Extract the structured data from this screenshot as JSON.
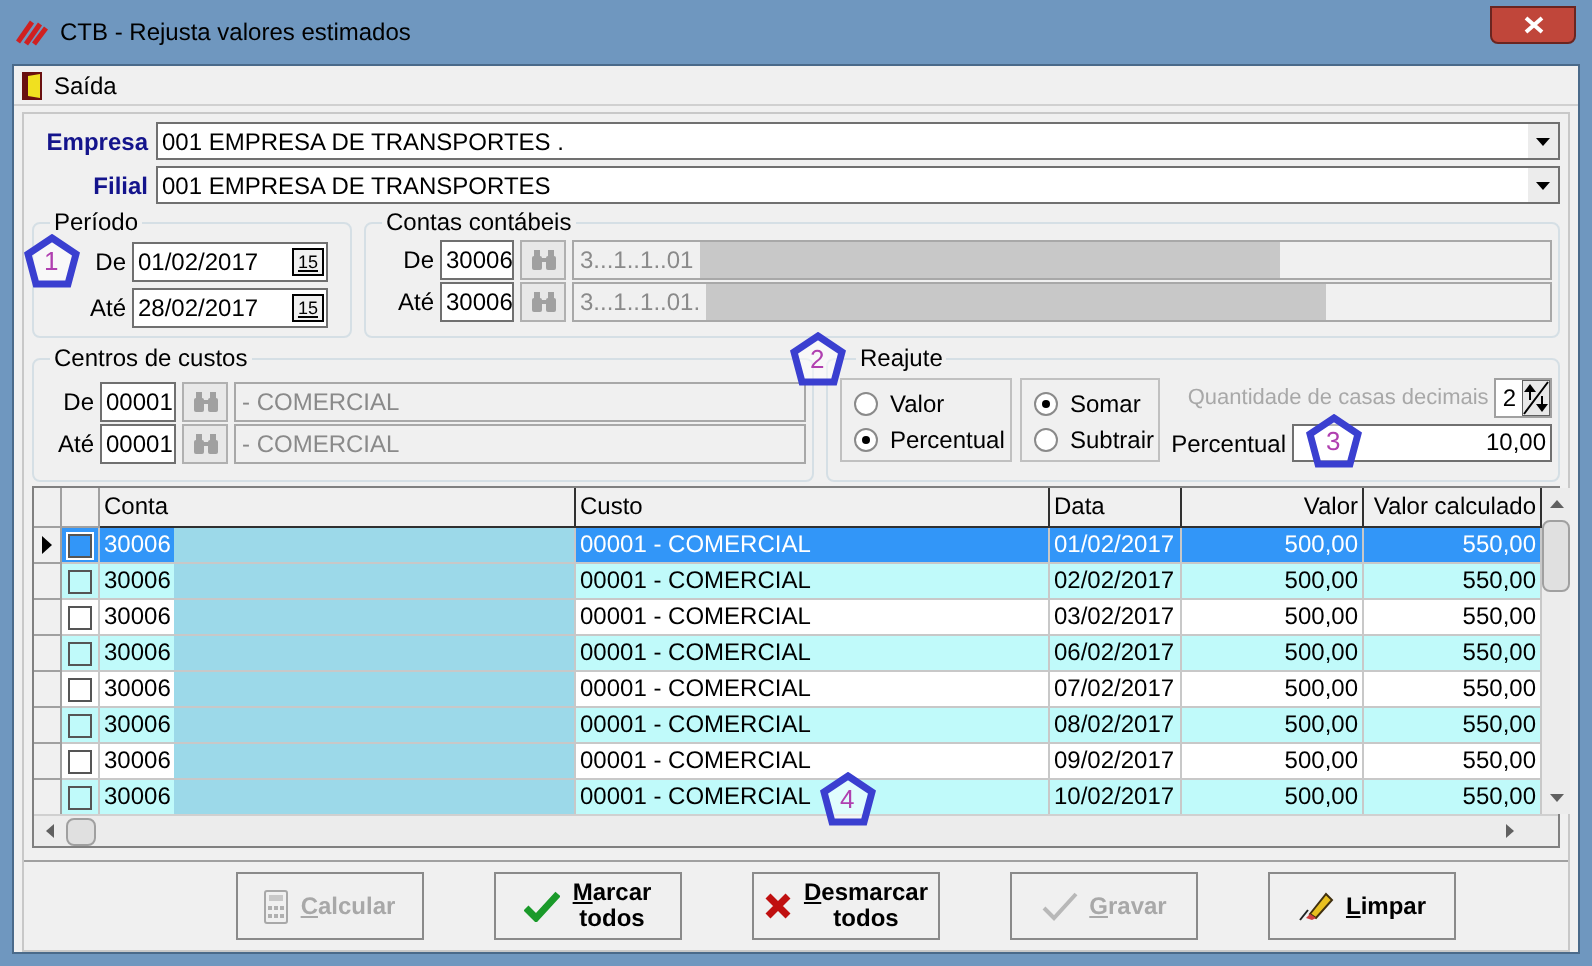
{
  "window": {
    "title": "CTB - Rejusta valores estimados"
  },
  "menu": [
    "Saída"
  ],
  "empresa": {
    "label": "Empresa",
    "value": "001 EMPRESA DE TRANSPORTES ."
  },
  "filial": {
    "label": "Filial",
    "value": "001 EMPRESA DE TRANSPORTES"
  },
  "periodo": {
    "title": "Período",
    "rows": [
      {
        "label": "De",
        "value": "01/02/2017",
        "button": "15"
      },
      {
        "label": "Até",
        "value": "28/02/2017",
        "button": "15"
      }
    ]
  },
  "contas": {
    "title": "Contas contábeis",
    "rows": [
      {
        "label": "De",
        "code": "30006",
        "description": "3...1..1..01"
      },
      {
        "label": "Até",
        "code": "30006",
        "description": "3...1..1..01."
      }
    ]
  },
  "centros": {
    "title": "Centros de custos",
    "rows": [
      {
        "label": "De",
        "code": "00001",
        "description": "- COMERCIAL"
      },
      {
        "label": "Até",
        "code": "00001",
        "description": "- COMERCIAL"
      }
    ]
  },
  "reajute": {
    "title": "Reajute",
    "tipo": [
      {
        "label": "Valor",
        "selected": false
      },
      {
        "label": "Percentual",
        "selected": true
      }
    ],
    "operacao": [
      {
        "label": "Somar",
        "selected": true
      },
      {
        "label": "Subtrair",
        "selected": false
      }
    ],
    "decimais": {
      "label": "Quantidade de casas decimais",
      "value": "2",
      "disabled": true
    },
    "percentual": {
      "label": "Percentual",
      "value": "10,00"
    }
  },
  "table": {
    "columns": [
      "Conta",
      "Custo",
      "Data",
      "Valor",
      "Valor calculado"
    ],
    "rows": [
      {
        "selected": true,
        "checked": false,
        "conta": "30006",
        "custo": "00001 - COMERCIAL",
        "data": "01/02/2017",
        "valor": "500,00",
        "calculado": "550,00"
      },
      {
        "selected": false,
        "checked": false,
        "conta": "30006",
        "custo": "00001 - COMERCIAL",
        "data": "02/02/2017",
        "valor": "500,00",
        "calculado": "550,00"
      },
      {
        "selected": false,
        "checked": false,
        "conta": "30006",
        "custo": "00001 - COMERCIAL",
        "data": "03/02/2017",
        "valor": "500,00",
        "calculado": "550,00"
      },
      {
        "selected": false,
        "checked": false,
        "conta": "30006",
        "custo": "00001 - COMERCIAL",
        "data": "06/02/2017",
        "valor": "500,00",
        "calculado": "550,00"
      },
      {
        "selected": false,
        "checked": false,
        "conta": "30006",
        "custo": "00001 - COMERCIAL",
        "data": "07/02/2017",
        "valor": "500,00",
        "calculado": "550,00"
      },
      {
        "selected": false,
        "checked": false,
        "conta": "30006",
        "custo": "00001 - COMERCIAL",
        "data": "08/02/2017",
        "valor": "500,00",
        "calculado": "550,00"
      },
      {
        "selected": false,
        "checked": false,
        "conta": "30006",
        "custo": "00001 - COMERCIAL",
        "data": "09/02/2017",
        "valor": "500,00",
        "calculado": "550,00"
      },
      {
        "selected": false,
        "checked": false,
        "conta": "30006",
        "custo": "00001 - COMERCIAL",
        "data": "10/02/2017",
        "valor": "500,00",
        "calculado": "550,00"
      }
    ]
  },
  "buttons": [
    {
      "kind": "calc",
      "label": "Calcular",
      "disabled": true
    },
    {
      "kind": "check",
      "label": "Marcar todos",
      "disabled": false
    },
    {
      "kind": "cross",
      "label": "Desmarcar todos",
      "disabled": false
    },
    {
      "kind": "save",
      "label": "Gravar",
      "disabled": true
    },
    {
      "kind": "eraser",
      "label": "Limpar",
      "disabled": false
    }
  ],
  "callouts": [
    "1",
    "2",
    "3",
    "4"
  ]
}
